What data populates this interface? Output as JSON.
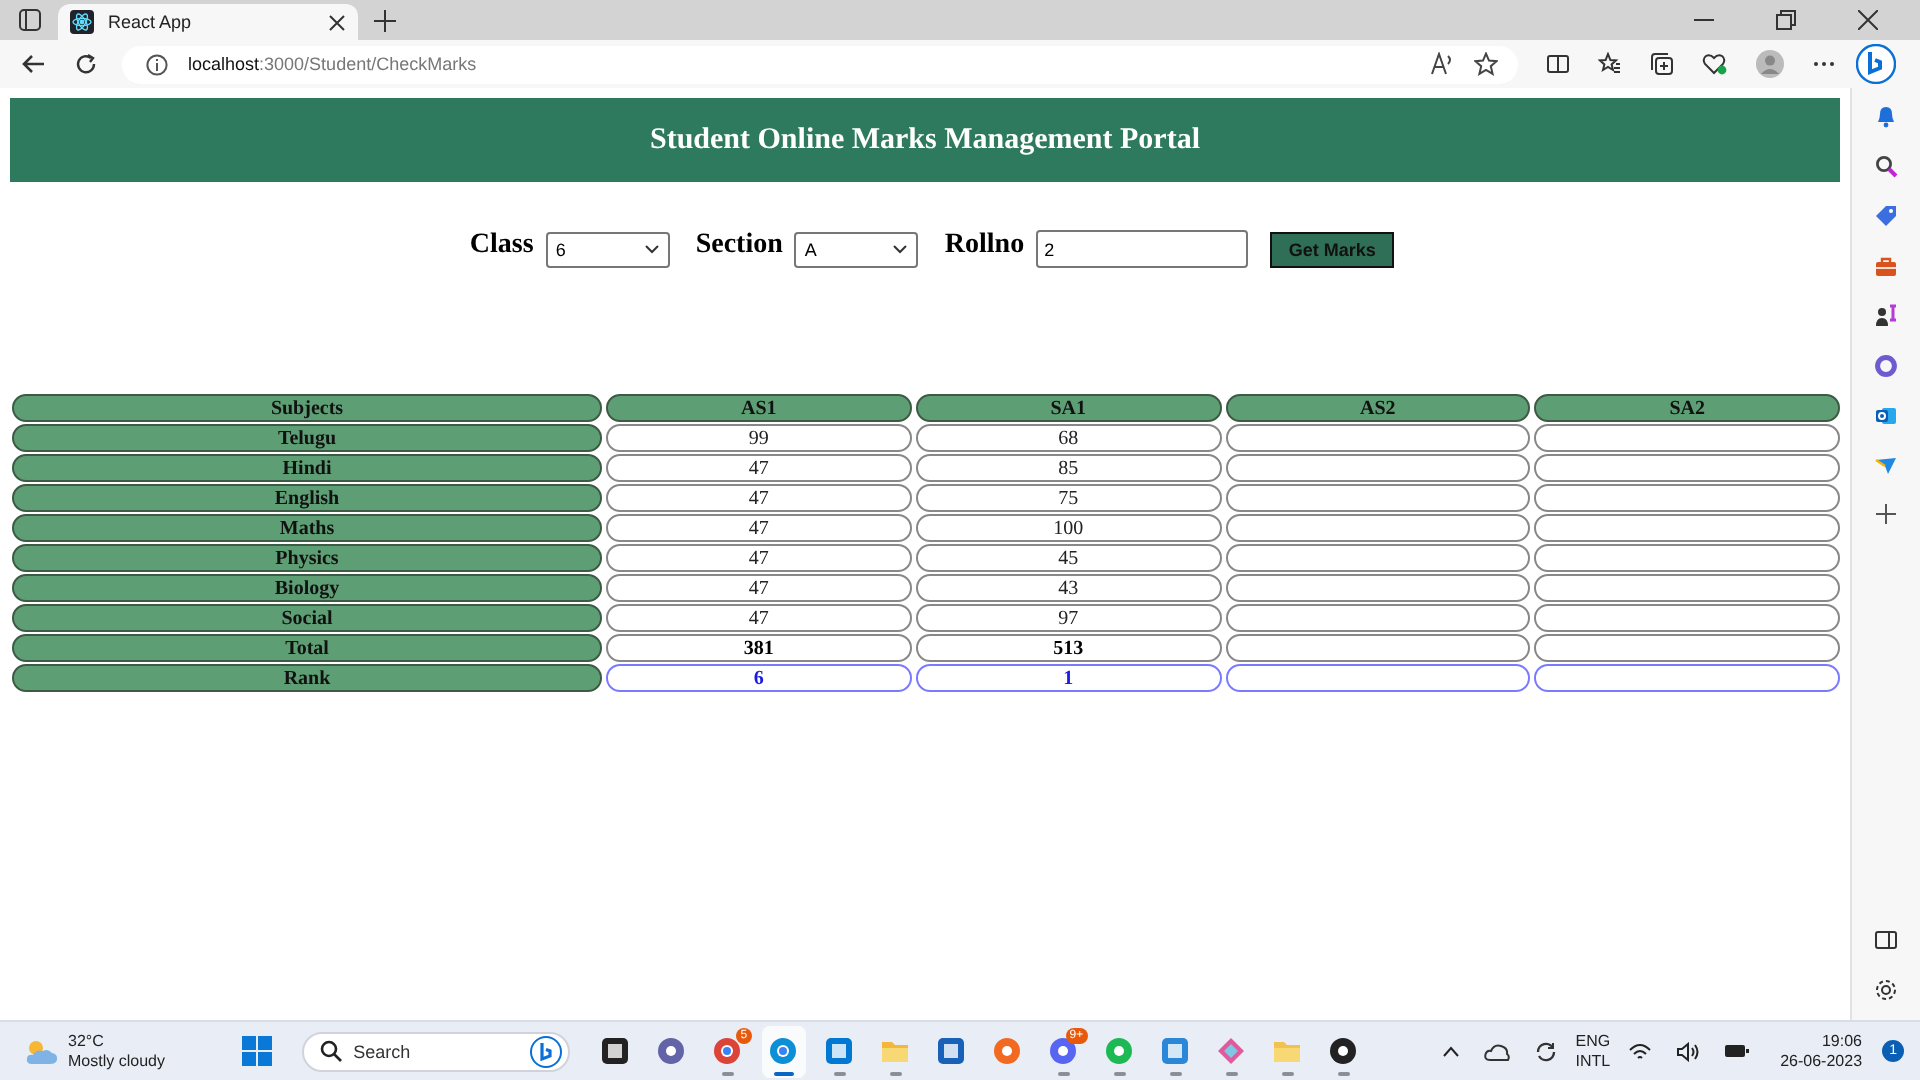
{
  "browser": {
    "tab_title": "React App",
    "url_host": "localhost",
    "url_path": ":3000/Student/CheckMarks"
  },
  "header": {
    "title": "Student Online Marks Management Portal"
  },
  "filters": {
    "class_label": "Class",
    "class_value": "6",
    "section_label": "Section",
    "section_value": "A",
    "rollno_label": "Rollno",
    "rollno_value": "2",
    "button": "Get Marks"
  },
  "table": {
    "columns": [
      "Subjects",
      "AS1",
      "SA1",
      "AS2",
      "SA2"
    ],
    "rows": [
      {
        "kind": "subject",
        "subject": "Telugu",
        "marks": [
          "99",
          "68"
        ]
      },
      {
        "kind": "subject",
        "subject": "Hindi",
        "marks": [
          "47",
          "85"
        ]
      },
      {
        "kind": "subject",
        "subject": "English",
        "marks": [
          "47",
          "75"
        ]
      },
      {
        "kind": "subject",
        "subject": "Maths",
        "marks": [
          "47",
          "100"
        ]
      },
      {
        "kind": "subject",
        "subject": "Physics",
        "marks": [
          "47",
          "45"
        ]
      },
      {
        "kind": "subject",
        "subject": "Biology",
        "marks": [
          "47",
          "43"
        ]
      },
      {
        "kind": "subject",
        "subject": "Social",
        "marks": [
          "47",
          "97"
        ]
      },
      {
        "kind": "total",
        "subject": "Total",
        "marks": [
          "381",
          "513"
        ]
      },
      {
        "kind": "rank",
        "subject": "Rank",
        "marks": [
          "6",
          "1"
        ]
      }
    ]
  },
  "taskbar": {
    "temperature": "32°C",
    "weather": "Mostly cloudy",
    "search_placeholder": "Search",
    "apps": [
      {
        "running": false,
        "selected": false
      },
      {
        "running": false,
        "selected": false
      },
      {
        "running": true,
        "selected": false,
        "badge": "5"
      },
      {
        "running": true,
        "selected": true
      },
      {
        "running": true,
        "selected": false
      },
      {
        "running": true,
        "selected": false
      },
      {
        "running": false,
        "selected": false
      },
      {
        "running": false,
        "selected": false
      },
      {
        "running": true,
        "selected": false,
        "badge": "9+"
      },
      {
        "running": true,
        "selected": false
      },
      {
        "running": true,
        "selected": false
      },
      {
        "running": true,
        "selected": false
      },
      {
        "running": true,
        "selected": false
      },
      {
        "running": true,
        "selected": false
      }
    ],
    "language": "ENG",
    "layout": "INTL",
    "time": "19:06",
    "date": "26-06-2023",
    "notifications": "1"
  }
}
